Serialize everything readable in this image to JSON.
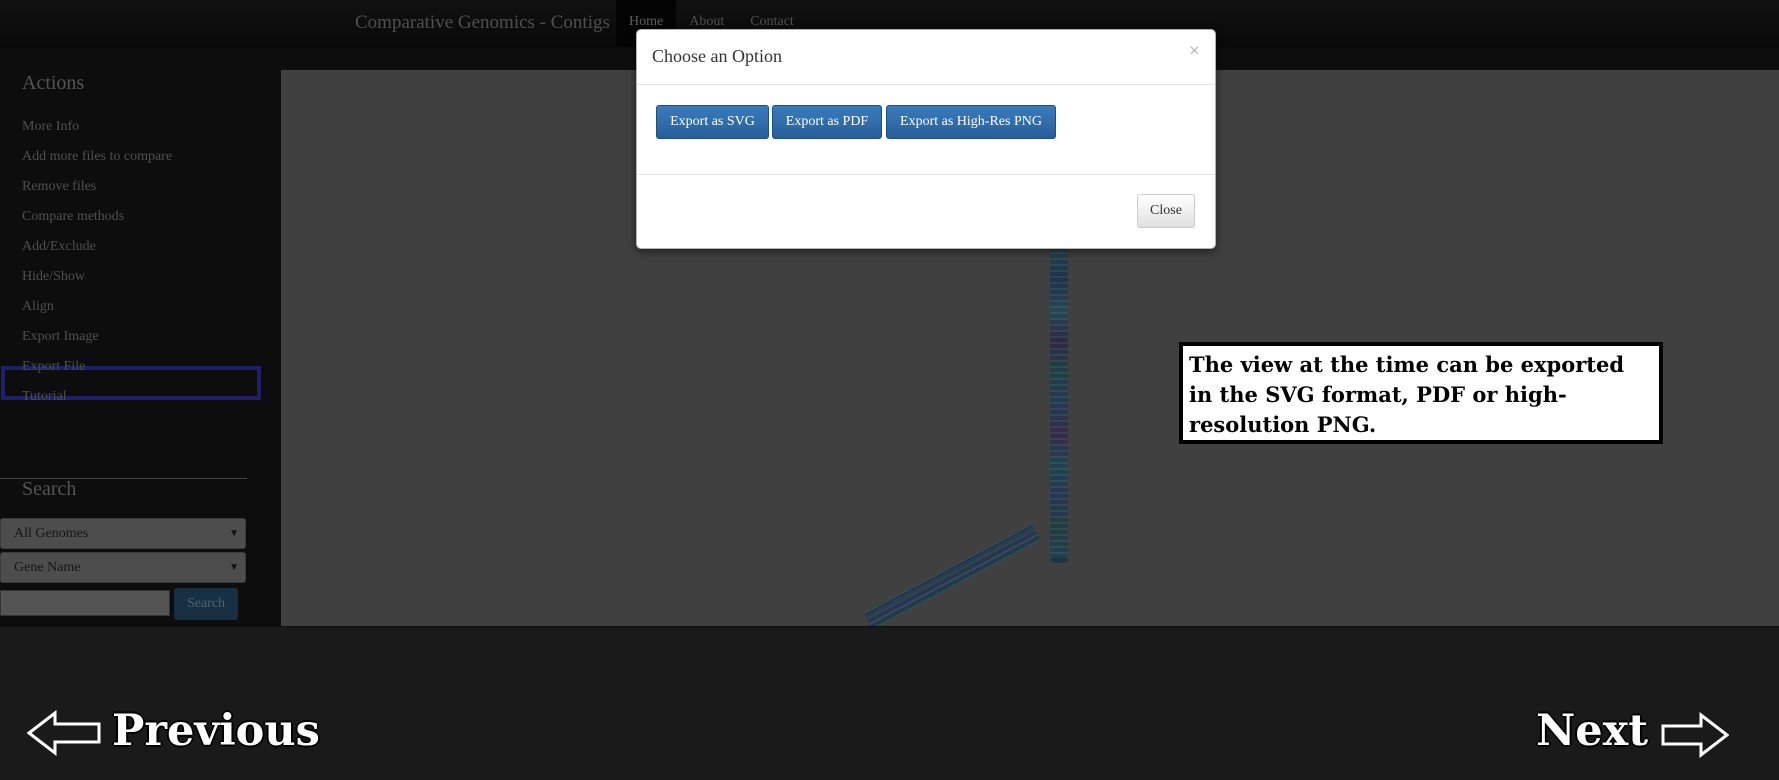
{
  "navbar": {
    "brand": "Comparative Genomics - Contigs",
    "links": [
      "Home",
      "About",
      "Contact"
    ]
  },
  "sidebar": {
    "actions_heading": "Actions",
    "actions": [
      "More Info",
      "Add more files to compare",
      "Remove files",
      "Compare methods",
      "Add/Exclude",
      "Hide/Show",
      "Align",
      "Export Image",
      "Export File",
      "Tutorial"
    ],
    "search_heading": "Search",
    "genome_select": "All Genomes",
    "field_select": "Gene Name",
    "search_input_value": "",
    "search_button": "Search"
  },
  "modal": {
    "title": "Choose an Option",
    "close_x": "×",
    "buttons": [
      "Export as SVG",
      "Export as PDF",
      "Export as High-Res PNG"
    ],
    "close_label": "Close"
  },
  "callout": {
    "text": "The view at the time can be exported in the SVG format, PDF or high-resolution PNG."
  },
  "footer": {
    "previous": "Previous",
    "next": "Next"
  },
  "colors": {
    "highlight": "#3a3fd0",
    "primary_button": "#2e6da4"
  }
}
